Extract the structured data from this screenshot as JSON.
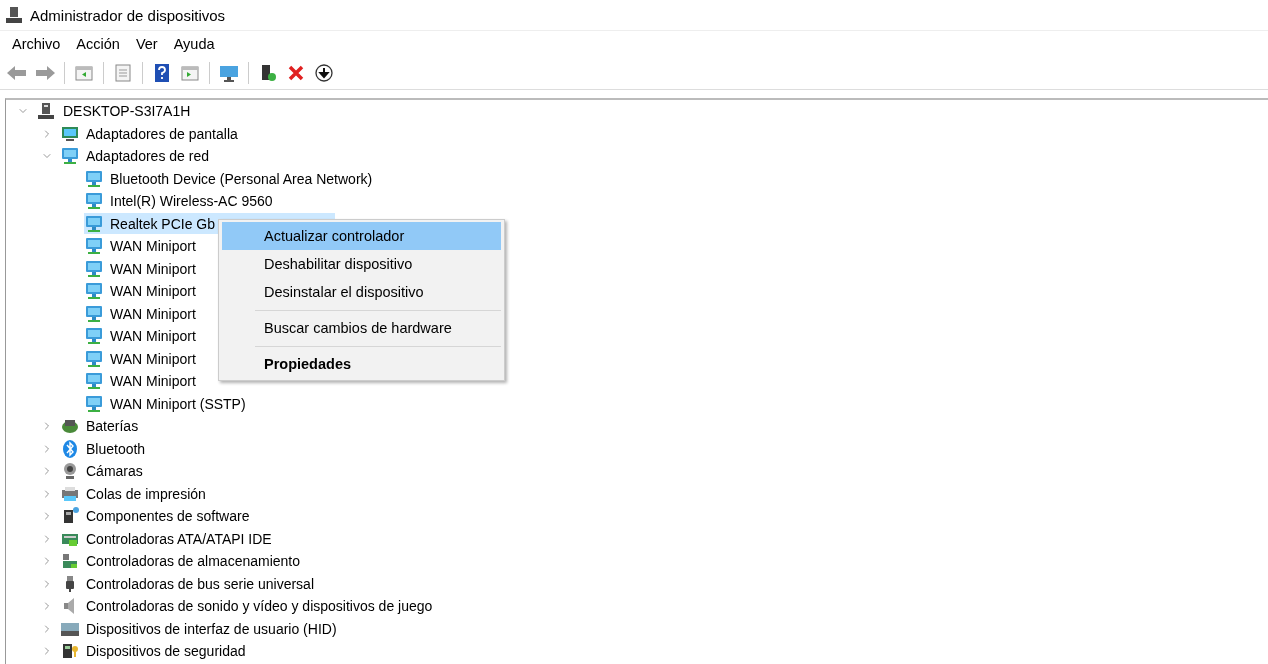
{
  "window": {
    "title": "Administrador de dispositivos"
  },
  "menu_bar": [
    "Archivo",
    "Acción",
    "Ver",
    "Ayuda"
  ],
  "tree": {
    "label": "DESKTOP-S3I7A1H",
    "expanded": true,
    "selected": false,
    "children": [
      {
        "label": "Adaptadores de pantalla",
        "expanded": false,
        "selected": false
      },
      {
        "label": "Adaptadores de red",
        "expanded": true,
        "selected": false,
        "children": [
          {
            "label": "Bluetooth Device (Personal Area Network)",
            "selected": false
          },
          {
            "label": "Intel(R) Wireless-AC 9560",
            "selected": false
          },
          {
            "label": "Realtek PCIe Gb",
            "selected": true
          },
          {
            "label": "WAN Miniport",
            "selected": false
          },
          {
            "label": "WAN Miniport",
            "selected": false
          },
          {
            "label": "WAN Miniport",
            "selected": false
          },
          {
            "label": "WAN Miniport",
            "selected": false
          },
          {
            "label": "WAN Miniport",
            "selected": false
          },
          {
            "label": "WAN Miniport",
            "selected": false
          },
          {
            "label": "WAN Miniport",
            "selected": false
          },
          {
            "label": "WAN Miniport (SSTP)",
            "selected": false
          }
        ]
      },
      {
        "label": "Baterías",
        "expanded": false,
        "selected": false
      },
      {
        "label": "Bluetooth",
        "expanded": false,
        "selected": false
      },
      {
        "label": "Cámaras",
        "expanded": false,
        "selected": false
      },
      {
        "label": "Colas de impresión",
        "expanded": false,
        "selected": false
      },
      {
        "label": "Componentes de software",
        "expanded": false,
        "selected": false
      },
      {
        "label": "Controladoras ATA/ATAPI IDE",
        "expanded": false,
        "selected": false
      },
      {
        "label": "Controladoras de almacenamiento",
        "expanded": false,
        "selected": false
      },
      {
        "label": "Controladoras de bus serie universal",
        "expanded": false,
        "selected": false
      },
      {
        "label": "Controladoras de sonido y vídeo y dispositivos de juego",
        "expanded": false,
        "selected": false
      },
      {
        "label": "Dispositivos de interfaz de usuario (HID)",
        "expanded": false,
        "selected": false
      },
      {
        "label": "Dispositivos de seguridad",
        "expanded": false,
        "selected": false
      }
    ]
  },
  "context_menu": {
    "groups": [
      [
        {
          "label": "Actualizar controlador",
          "selected": true,
          "default": false
        },
        {
          "label": "Deshabilitar dispositivo",
          "selected": false,
          "default": false
        },
        {
          "label": "Desinstalar el dispositivo",
          "selected": false,
          "default": false
        }
      ],
      [
        {
          "label": "Buscar cambios de hardware",
          "selected": false,
          "default": false
        }
      ],
      [
        {
          "label": "Propiedades",
          "selected": false,
          "default": true
        }
      ]
    ]
  }
}
